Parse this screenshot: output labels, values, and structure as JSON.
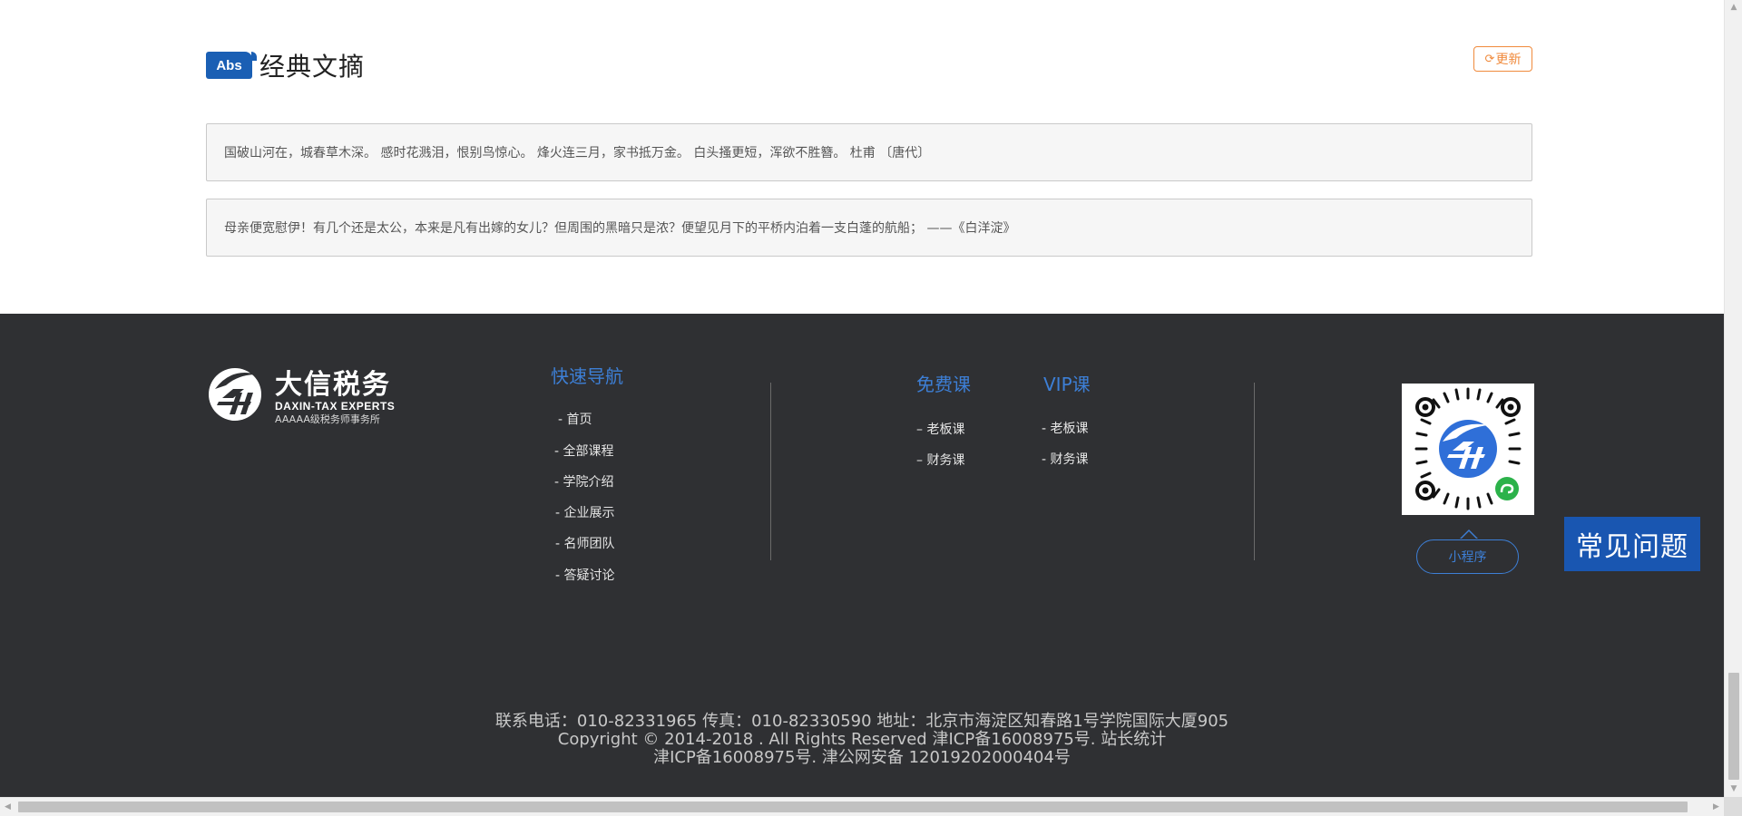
{
  "quotes_section": {
    "badge": "Abs",
    "title": "经典文摘",
    "refresh_label": "更新",
    "quotes": [
      "国破山河在，城春草木深。 感时花溅泪，恨别鸟惊心。 烽火连三月，家书抵万金。 白头搔更短，浑欲不胜簪。 杜甫 〔唐代〕",
      "母亲便宽慰伊！有几个还是太公，本来是凡有出嫁的女儿？但周围的黑暗只是浓？便望见月下的平桥内泊着一支白蓬的航船； ——《白洋淀》"
    ]
  },
  "footer": {
    "logo": {
      "cn": "大信税务",
      "en": "DAXIN-TAX EXPERTS",
      "sub": "AAAAA级税务师事务所"
    },
    "quick_nav": {
      "title": "快速导航",
      "items": [
        "- 首页",
        "- 全部课程",
        "- 学院介绍",
        "- 企业展示",
        "- 名师团队",
        "- 答疑讨论"
      ]
    },
    "free_courses": {
      "title": "免费课",
      "items": [
        "– 老板课",
        "– 财务课"
      ]
    },
    "vip_courses": {
      "title": "VIP课",
      "items": [
        "- 老板课",
        "- 财务课"
      ]
    },
    "miniprogram_label": "小程序",
    "faq_label": "常见问题",
    "info": {
      "line1": "联系电话：010-82331965   传真：010-82330590   地址：北京市海淀区知春路1号学院国际大厦905",
      "line2": "Copyright © 2014-2018 . All Rights Reserved 津ICP备16008975号. 站长统计",
      "line3": "津ICP备16008975号. 津公网安备 12019202000404号"
    }
  },
  "colors": {
    "brand_blue": "#1a5fb4",
    "link_blue": "#3d7fd6",
    "refresh_orange": "#f08a3c",
    "footer_bg": "#2f3033",
    "faq_bg": "#1956b1"
  },
  "icons": {
    "refresh": "refresh-icon",
    "logo": "daxin-logo-icon",
    "qr": "qr-code-icon",
    "miniprogram": "miniprogram-icon"
  }
}
